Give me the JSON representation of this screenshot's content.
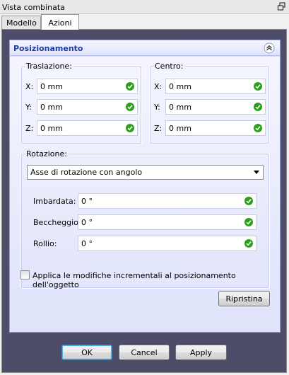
{
  "window": {
    "title": "Vista combinata"
  },
  "tabs": [
    {
      "label": "Modello"
    },
    {
      "label": "Azioni"
    }
  ],
  "section": {
    "title": "Posizionamento"
  },
  "translation": {
    "title": "Traslazione:",
    "fields": [
      {
        "label": "X:",
        "value": "0 mm"
      },
      {
        "label": "Y:",
        "value": "0 mm"
      },
      {
        "label": "Z:",
        "value": "0 mm"
      }
    ]
  },
  "center": {
    "title": "Centro:",
    "fields": [
      {
        "label": "X:",
        "value": "0 mm"
      },
      {
        "label": "Y:",
        "value": "0 mm"
      },
      {
        "label": "Z:",
        "value": "0 mm"
      }
    ]
  },
  "rotation": {
    "title": "Rotazione:",
    "mode": "Asse di rotazione con angolo",
    "fields": [
      {
        "label": "Imbardata:",
        "value": "0 °"
      },
      {
        "label": "Beccheggio:",
        "value": "0 °"
      },
      {
        "label": "Rollio:",
        "value": "0 °"
      }
    ]
  },
  "incremental": {
    "label": "Applica le modifiche incrementali al posizionamento dell'oggetto",
    "checked": false
  },
  "buttons": {
    "reset": "Ripristina",
    "ok": "OK",
    "cancel": "Cancel",
    "apply": "Apply"
  },
  "colors": {
    "header_text": "#1f3ea0",
    "panel_bg": "#4d4d6a",
    "ok_green": "#2aa11b"
  }
}
